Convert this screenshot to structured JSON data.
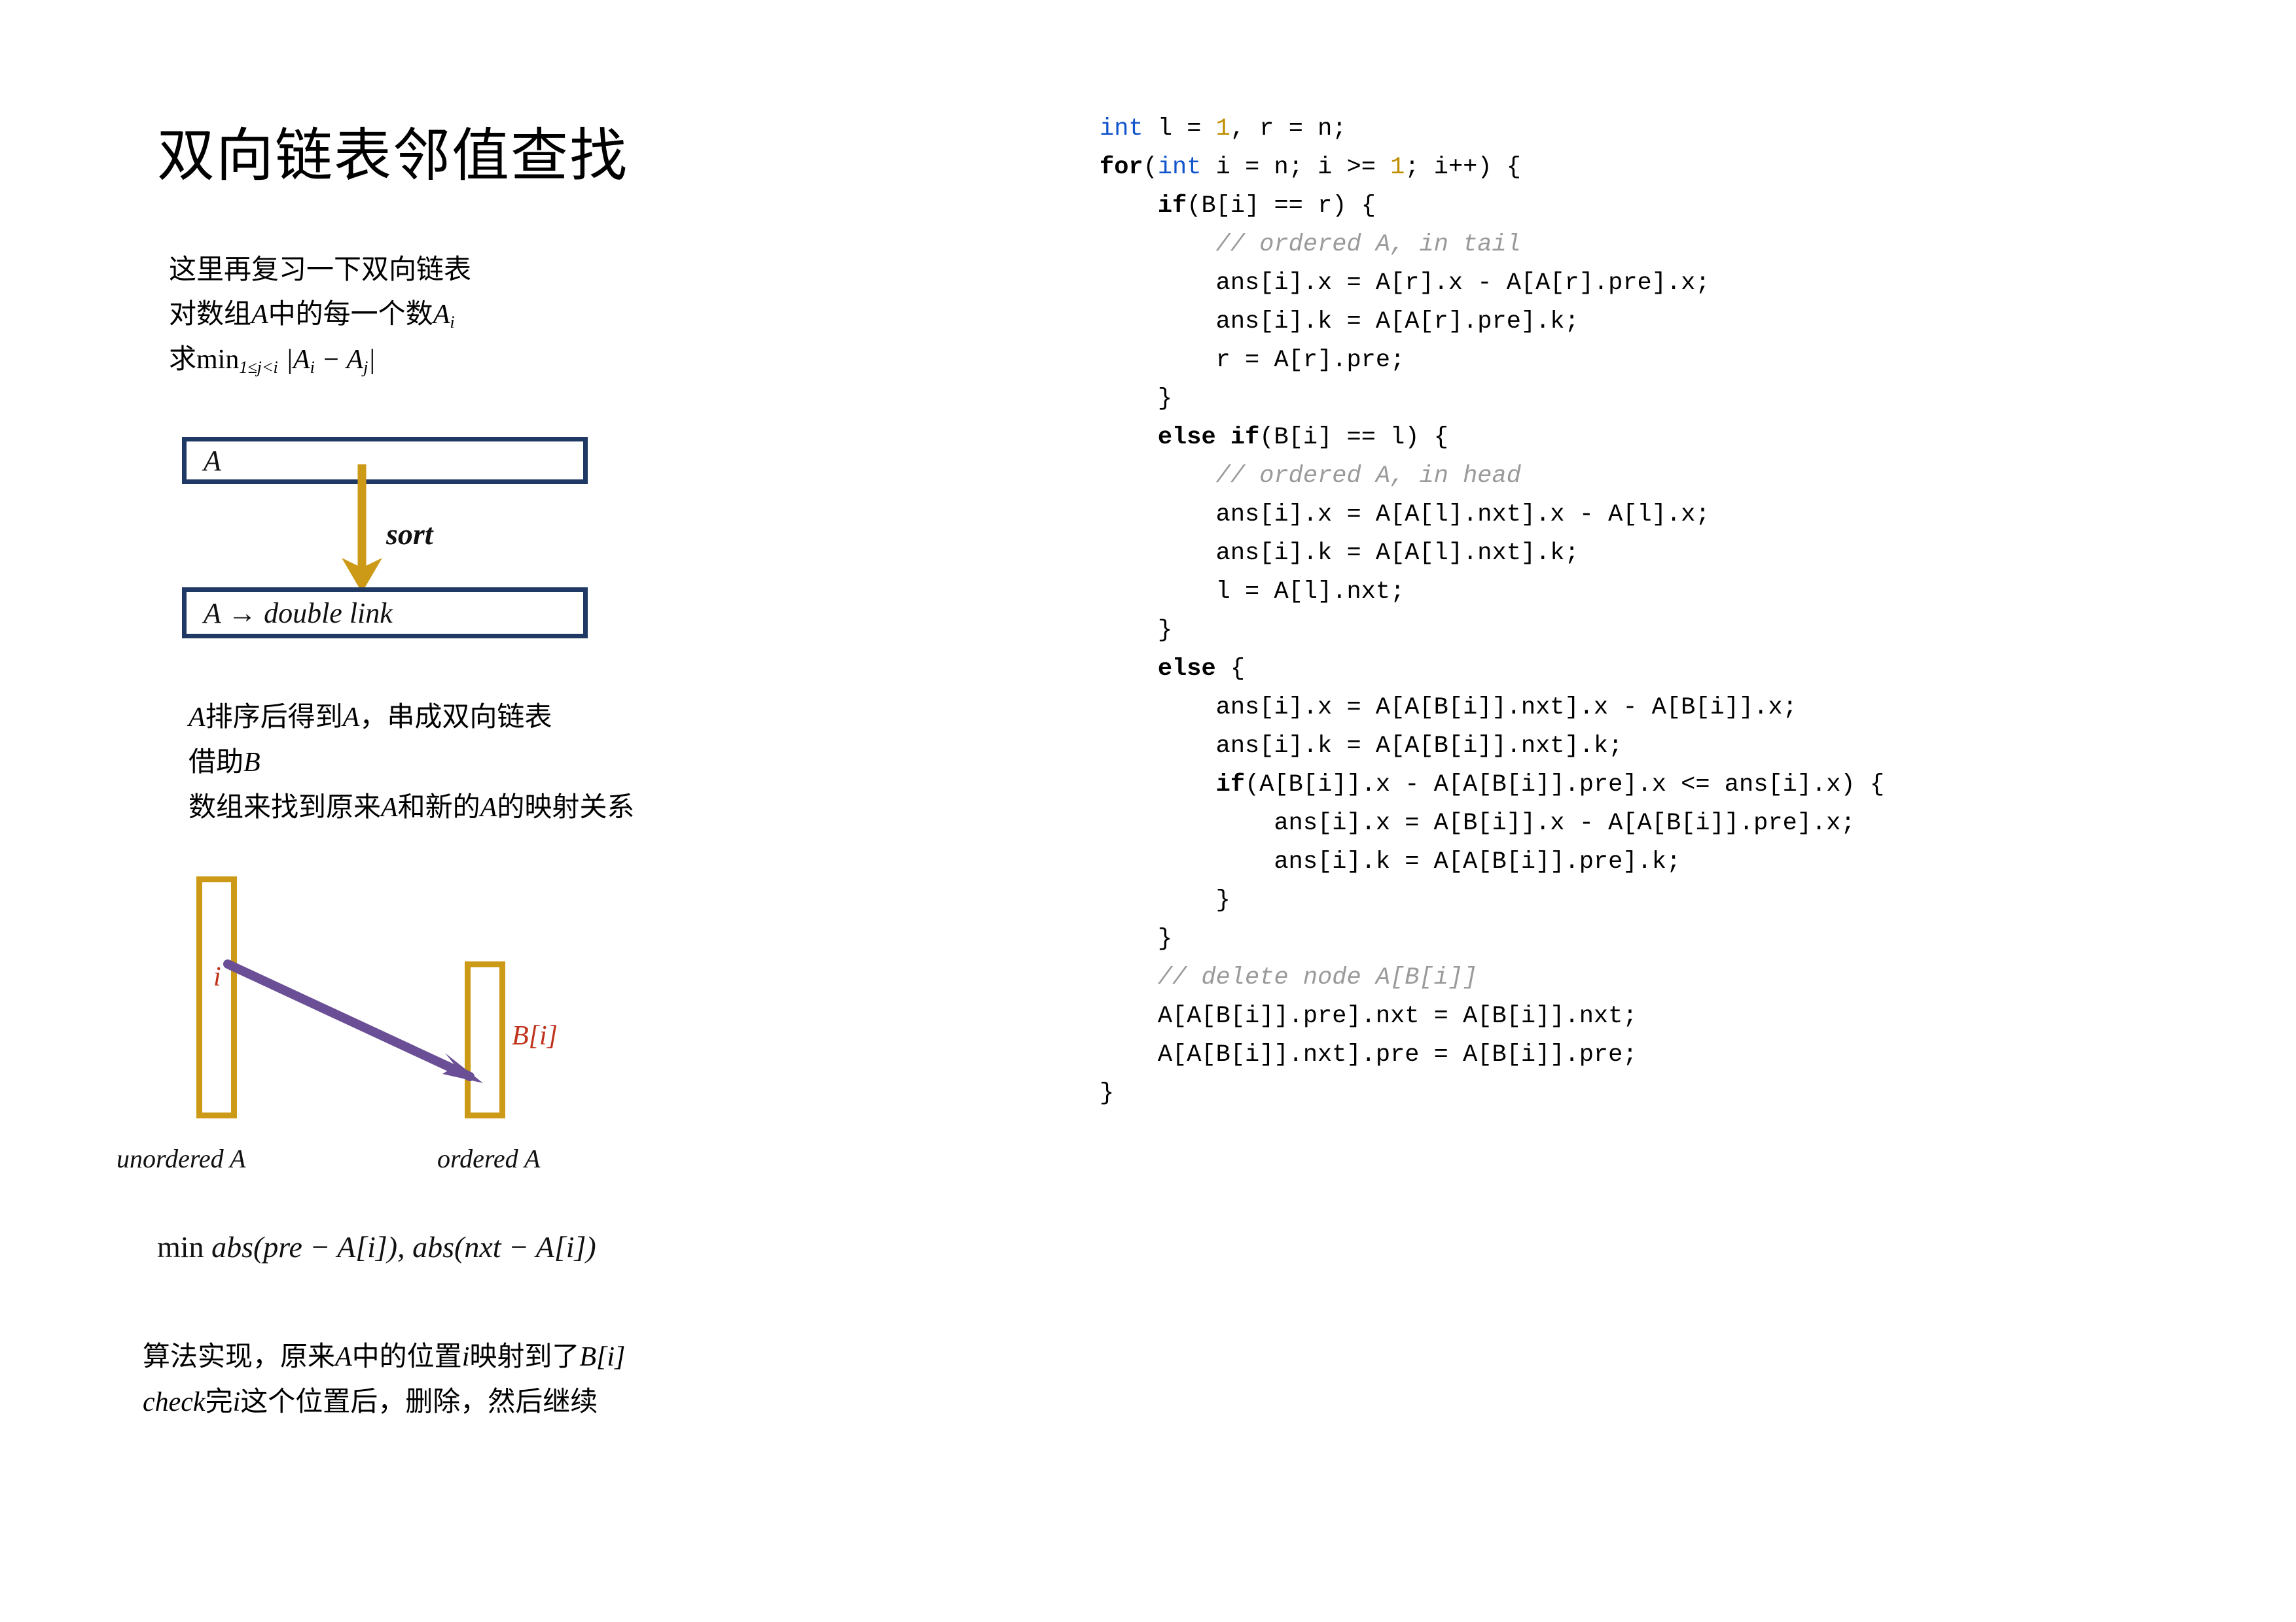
{
  "title": "双向链表邻值查找",
  "intro": {
    "line1": "这里再复习一下双向链表",
    "line2_pre": "对数组",
    "line2_a": "A",
    "line2_mid": "中的每一个数",
    "line2_ai_base": "A",
    "line2_ai_sub": "i",
    "line3_pre": "求",
    "line3_min": "min",
    "line3_minsub": "1≤j<i",
    "line3_expr": "|A",
    "line3_sub1": "i",
    "line3_minus": " − A",
    "line3_sub2": "j",
    "line3_end": "|"
  },
  "flow": {
    "box_a_label": "A",
    "box_dlink_label": "A → double link",
    "sort_label": "sort",
    "arrow_color": "#cc9a17",
    "box_border_color": "#1f3864"
  },
  "mapping_text": {
    "line1_pre": "A",
    "line1_mid": "排序后得到",
    "line1_a2": "A",
    "line1_end": "，串成双向链表",
    "line2_pre": "借助",
    "line2_b": "B",
    "line3_pre": "数组来找到原来",
    "line3_a1": "A",
    "line3_mid": "和新的",
    "line3_a2": "A",
    "line3_end": "的映射关系"
  },
  "mapping_diagram": {
    "bar_color": "#cc9a17",
    "arrow_color": "#6b4f96",
    "label_color": "#c0321b",
    "label_i": "i",
    "label_bi_b": "B",
    "label_bi_rest": "[i]",
    "caption_unordered": "unordered A",
    "caption_ordered": "ordered A"
  },
  "min_formula": {
    "min": "min",
    "rest": " abs(pre  − A[i]), abs(nxt  − A[i])"
  },
  "algo_text": {
    "line1_pre": "算法实现，原来",
    "line1_a": "A",
    "line1_mid": "中的位置",
    "line1_i": "i",
    "line1_mid2": "映射到了",
    "line1_b": "B",
    "line1_bi": "[i]",
    "line2_check": "check",
    "line2_mid": "完",
    "line2_i": "i",
    "line2_end": "这个位置后，删除，然后继续"
  },
  "code": {
    "language": "cpp",
    "keyword_color": "#1155cc",
    "number_color": "#bf8f00",
    "comment_color": "#9a9a9a",
    "lines": [
      "int l = 1, r = n;",
      "for(int i = n; i >= 1; i++) {",
      "    if(B[i] == r) {",
      "        // ordered A, in tail",
      "        ans[i].x = A[r].x - A[A[r].pre].x;",
      "        ans[i].k = A[A[r].pre].k;",
      "        r = A[r].pre;",
      "    }",
      "    else if(B[i] == l) {",
      "        // ordered A, in head",
      "        ans[i].x = A[A[l].nxt].x - A[l].x;",
      "        ans[i].k = A[A[l].nxt].k;",
      "        l = A[l].nxt;",
      "    }",
      "    else {",
      "        ans[i].x = A[A[B[i]].nxt].x - A[B[i]].x;",
      "        ans[i].k = A[A[B[i]].nxt].k;",
      "        if(A[B[i]].x - A[A[B[i]].pre].x <= ans[i].x) {",
      "            ans[i].x = A[B[i]].x - A[A[B[i]].pre].x;",
      "            ans[i].k = A[A[B[i]].pre].k;",
      "        }",
      "    }",
      "    // delete node A[B[i]]",
      "    A[A[B[i]].pre].nxt = A[B[i]].nxt;",
      "    A[A[B[i]].nxt].pre = A[B[i]].pre;",
      "}"
    ]
  }
}
